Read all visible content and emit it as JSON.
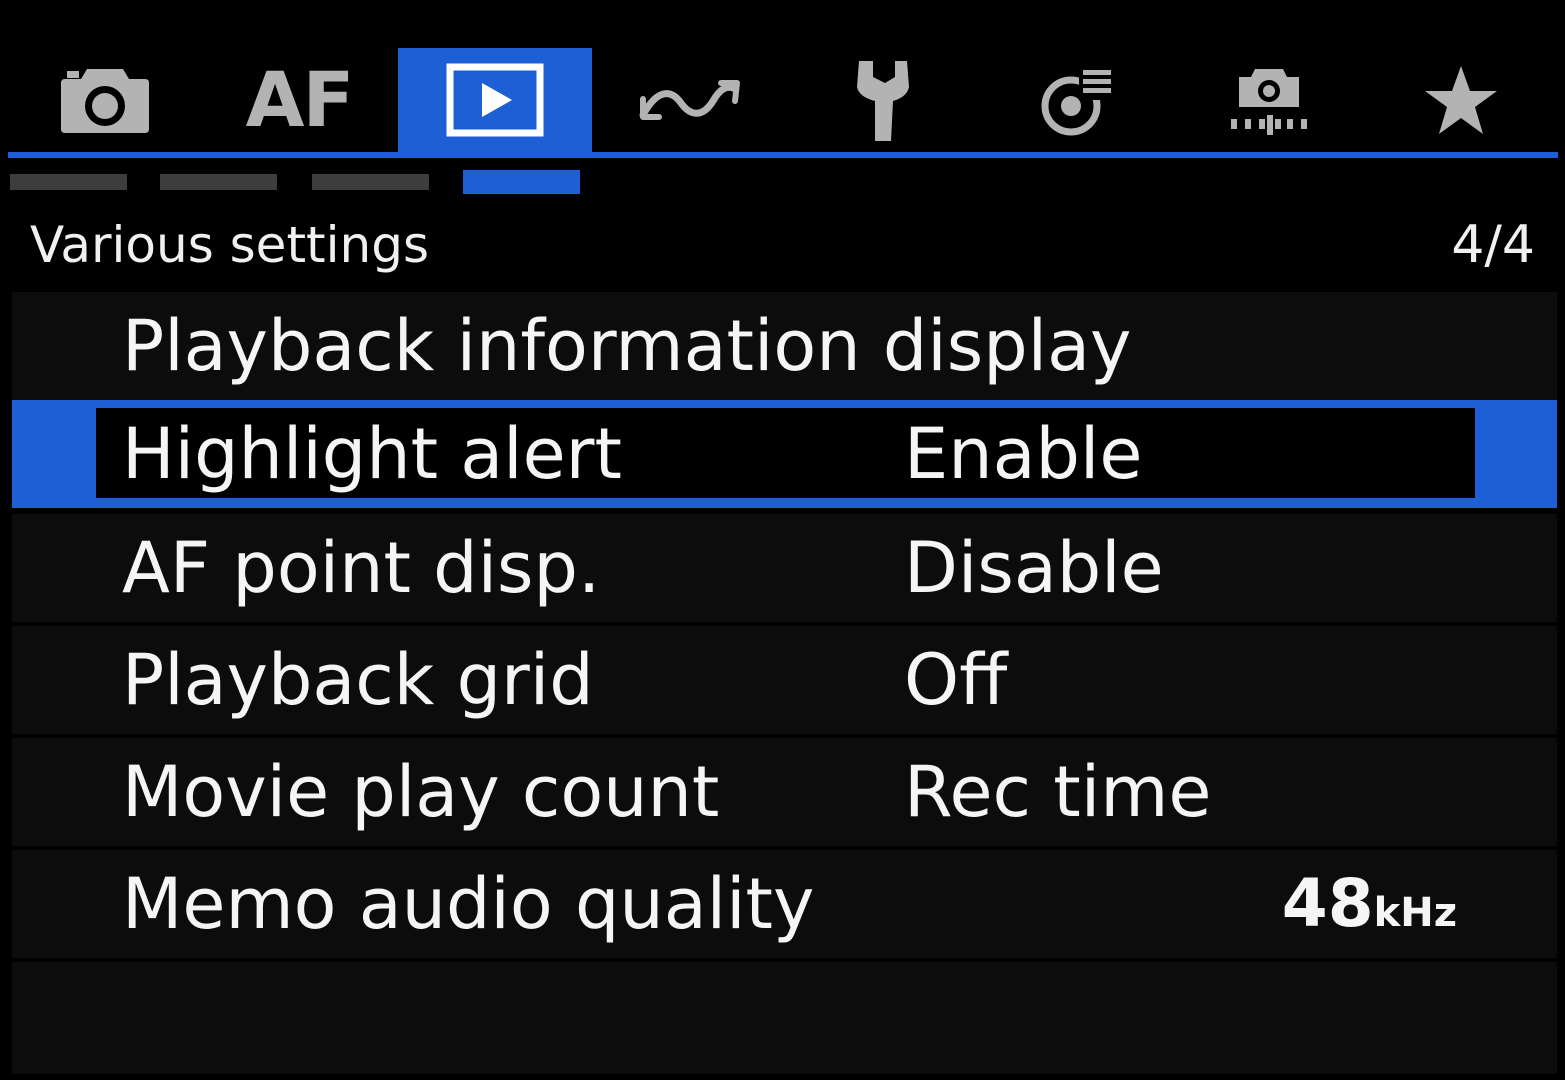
{
  "tabs": [
    {
      "name": "shooting",
      "icon": "camera-icon",
      "label": ""
    },
    {
      "name": "af",
      "icon": "",
      "label": "AF"
    },
    {
      "name": "playback",
      "icon": "play-icon",
      "label": "",
      "active": true
    },
    {
      "name": "wireless",
      "icon": "wireless-wave-icon",
      "label": ""
    },
    {
      "name": "setup",
      "icon": "wrench-icon",
      "label": ""
    },
    {
      "name": "custom-functions",
      "icon": "custom-functions-icon",
      "label": ""
    },
    {
      "name": "custom-shooting-mode",
      "icon": "custom-camera-icon",
      "label": ""
    },
    {
      "name": "my-menu",
      "icon": "star-icon",
      "label": ""
    }
  ],
  "page_indicators": {
    "count": 4,
    "active_index": 3
  },
  "header": {
    "title": "Various settings",
    "page": "4/4"
  },
  "menu": {
    "items": [
      {
        "label": "Playback information display",
        "value": ""
      },
      {
        "label": "Highlight alert",
        "value": "Enable",
        "selected": true
      },
      {
        "label": "AF point disp.",
        "value": "Disable"
      },
      {
        "label": "Playback grid",
        "value": "Off"
      },
      {
        "label": "Movie play count",
        "value": "Rec time"
      },
      {
        "label": "Memo audio quality",
        "value": "48",
        "value_unit": "kHz"
      }
    ]
  },
  "colors": {
    "accent": "#1f5fd6",
    "background": "#000000",
    "row_background": "#0c0c0c",
    "inactive_icon": "#b0b0b0",
    "inactive_page_indicator": "#3d3d3d"
  }
}
